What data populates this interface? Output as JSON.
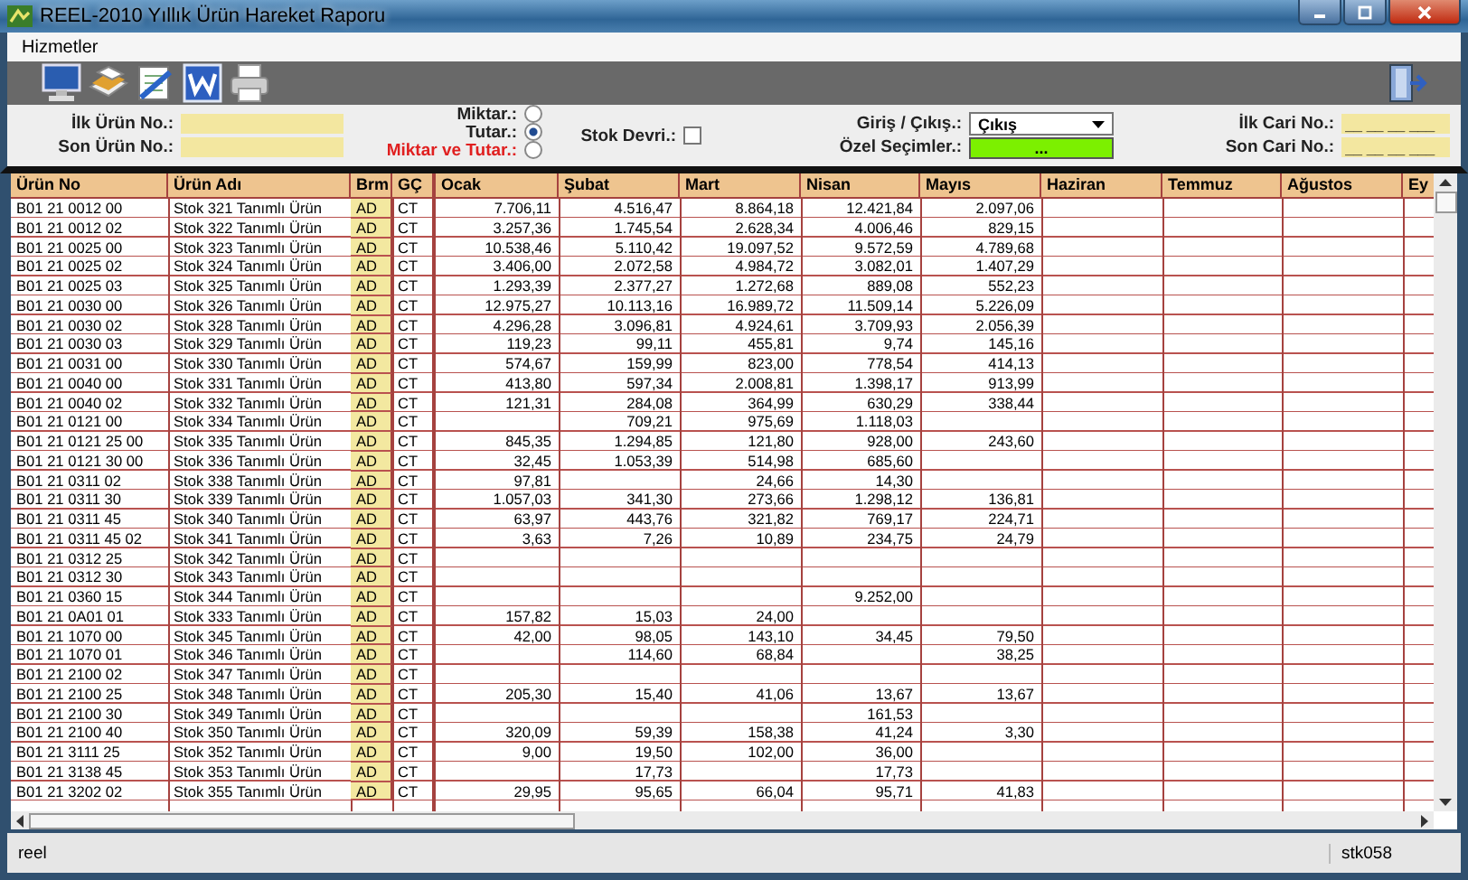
{
  "window": {
    "title": "REEL-2010 Yıllık Ürün Hareket Raporu"
  },
  "menu": [
    "Hizmetler"
  ],
  "filters": {
    "first_product": {
      "label": "İlk Ürün No.:"
    },
    "last_product": {
      "label": "Son Ürün No.:"
    },
    "radios": [
      {
        "label": "Miktar.:",
        "selected": false,
        "kind": "normal"
      },
      {
        "label": "Tutar.:",
        "selected": true,
        "kind": "normal"
      },
      {
        "label": "Miktar ve Tutar.:",
        "selected": false,
        "kind": "highlight"
      }
    ],
    "stock_turnover": {
      "label": "Stok Devri.:",
      "checked": false
    },
    "direction": {
      "label": "Giriş / Çıkış.:",
      "value": "Çıkış"
    },
    "special": {
      "label": "Özel Seçimler.:",
      "button": "..."
    },
    "first_account": {
      "label": "İlk Cari No.:",
      "value": "__ __ __ ___"
    },
    "last_account": {
      "label": "Son Cari No.:",
      "value": "__ __ __ ___"
    }
  },
  "table": {
    "columns": [
      "Ürün No",
      "Ürün Adı",
      "Brm",
      "GÇ",
      "Ocak",
      "Şubat",
      "Mart",
      "Nisan",
      "Mayıs",
      "Haziran",
      "Temmuz",
      "Ağustos",
      "Ey"
    ],
    "rows": [
      {
        "code": "B01 21 0012 00",
        "name": "Stok 321 Tanımlı Ürün",
        "unit": "AD",
        "gc": "CT",
        "ocak": "7.706,11",
        "subat": "4.516,47",
        "mart": "8.864,18",
        "nisan": "12.421,84",
        "mayis": "2.097,06"
      },
      {
        "code": "B01 21 0012 02",
        "name": "Stok 322 Tanımlı Ürün",
        "unit": "AD",
        "gc": "CT",
        "ocak": "3.257,36",
        "subat": "1.745,54",
        "mart": "2.628,34",
        "nisan": "4.006,46",
        "mayis": "829,15"
      },
      {
        "code": "B01 21 0025 00",
        "name": "Stok 323 Tanımlı Ürün",
        "unit": "AD",
        "gc": "CT",
        "ocak": "10.538,46",
        "subat": "5.110,42",
        "mart": "19.097,52",
        "nisan": "9.572,59",
        "mayis": "4.789,68"
      },
      {
        "code": "B01 21 0025 02",
        "name": "Stok 324 Tanımlı Ürün",
        "unit": "AD",
        "gc": "CT",
        "ocak": "3.406,00",
        "subat": "2.072,58",
        "mart": "4.984,72",
        "nisan": "3.082,01",
        "mayis": "1.407,29"
      },
      {
        "code": "B01 21 0025 03",
        "name": "Stok 325 Tanımlı Ürün",
        "unit": "AD",
        "gc": "CT",
        "ocak": "1.293,39",
        "subat": "2.377,27",
        "mart": "1.272,68",
        "nisan": "889,08",
        "mayis": "552,23"
      },
      {
        "code": "B01 21 0030 00",
        "name": "Stok 326 Tanımlı Ürün",
        "unit": "AD",
        "gc": "CT",
        "ocak": "12.975,27",
        "subat": "10.113,16",
        "mart": "16.989,72",
        "nisan": "11.509,14",
        "mayis": "5.226,09"
      },
      {
        "code": "B01 21 0030 02",
        "name": "Stok 328 Tanımlı Ürün",
        "unit": "AD",
        "gc": "CT",
        "ocak": "4.296,28",
        "subat": "3.096,81",
        "mart": "4.924,61",
        "nisan": "3.709,93",
        "mayis": "2.056,39"
      },
      {
        "code": "B01 21 0030 03",
        "name": "Stok 329 Tanımlı Ürün",
        "unit": "AD",
        "gc": "CT",
        "ocak": "119,23",
        "subat": "99,11",
        "mart": "455,81",
        "nisan": "9,74",
        "mayis": "145,16"
      },
      {
        "code": "B01 21 0031 00",
        "name": "Stok 330 Tanımlı Ürün",
        "unit": "AD",
        "gc": "CT",
        "ocak": "574,67",
        "subat": "159,99",
        "mart": "823,00",
        "nisan": "778,54",
        "mayis": "414,13"
      },
      {
        "code": "B01 21 0040 00",
        "name": "Stok 331 Tanımlı Ürün",
        "unit": "AD",
        "gc": "CT",
        "ocak": "413,80",
        "subat": "597,34",
        "mart": "2.008,81",
        "nisan": "1.398,17",
        "mayis": "913,99"
      },
      {
        "code": "B01 21 0040 02",
        "name": "Stok 332 Tanımlı Ürün",
        "unit": "AD",
        "gc": "CT",
        "ocak": "121,31",
        "subat": "284,08",
        "mart": "364,99",
        "nisan": "630,29",
        "mayis": "338,44"
      },
      {
        "code": "B01 21 0121 00",
        "name": "Stok 334 Tanımlı Ürün",
        "unit": "AD",
        "gc": "CT",
        "subat": "709,21",
        "mart": "975,69",
        "nisan": "1.118,03"
      },
      {
        "code": "B01 21 0121 25 00",
        "name": "Stok 335 Tanımlı Ürün",
        "unit": "AD",
        "gc": "CT",
        "ocak": "845,35",
        "subat": "1.294,85",
        "mart": "121,80",
        "nisan": "928,00",
        "mayis": "243,60"
      },
      {
        "code": "B01 21 0121 30 00",
        "name": "Stok 336 Tanımlı Ürün",
        "unit": "AD",
        "gc": "CT",
        "ocak": "32,45",
        "subat": "1.053,39",
        "mart": "514,98",
        "nisan": "685,60"
      },
      {
        "code": "B01 21 0311 02",
        "name": "Stok 338 Tanımlı Ürün",
        "unit": "AD",
        "gc": "CT",
        "ocak": "97,81",
        "mart": "24,66",
        "nisan": "14,30"
      },
      {
        "code": "B01 21 0311 30",
        "name": "Stok 339 Tanımlı Ürün",
        "unit": "AD",
        "gc": "CT",
        "ocak": "1.057,03",
        "subat": "341,30",
        "mart": "273,66",
        "nisan": "1.298,12",
        "mayis": "136,81"
      },
      {
        "code": "B01 21 0311 45",
        "name": "Stok 340 Tanımlı Ürün",
        "unit": "AD",
        "gc": "CT",
        "ocak": "63,97",
        "subat": "443,76",
        "mart": "321,82",
        "nisan": "769,17",
        "mayis": "224,71"
      },
      {
        "code": "B01 21 0311 45 02",
        "name": "Stok 341 Tanımlı Ürün",
        "unit": "AD",
        "gc": "CT",
        "ocak": "3,63",
        "subat": "7,26",
        "mart": "10,89",
        "nisan": "234,75",
        "mayis": "24,79"
      },
      {
        "code": "B01 21 0312 25",
        "name": "Stok 342 Tanımlı Ürün",
        "unit": "AD",
        "gc": "CT"
      },
      {
        "code": "B01 21 0312 30",
        "name": "Stok 343 Tanımlı Ürün",
        "unit": "AD",
        "gc": "CT"
      },
      {
        "code": "B01 21 0360 15",
        "name": "Stok 344 Tanımlı Ürün",
        "unit": "AD",
        "gc": "CT",
        "nisan": "9.252,00"
      },
      {
        "code": "B01 21 0A01 01",
        "name": "Stok 333 Tanımlı Ürün",
        "unit": "AD",
        "gc": "CT",
        "ocak": "157,82",
        "subat": "15,03",
        "mart": "24,00"
      },
      {
        "code": "B01 21 1070 00",
        "name": "Stok 345 Tanımlı Ürün",
        "unit": "AD",
        "gc": "CT",
        "ocak": "42,00",
        "subat": "98,05",
        "mart": "143,10",
        "nisan": "34,45",
        "mayis": "79,50"
      },
      {
        "code": "B01 21 1070 01",
        "name": "Stok 346 Tanımlı Ürün",
        "unit": "AD",
        "gc": "CT",
        "subat": "114,60",
        "mart": "68,84",
        "mayis": "38,25"
      },
      {
        "code": "B01 21 2100 02",
        "name": "Stok 347 Tanımlı Ürün",
        "unit": "AD",
        "gc": "CT"
      },
      {
        "code": "B01 21 2100 25",
        "name": "Stok 348 Tanımlı Ürün",
        "unit": "AD",
        "gc": "CT",
        "ocak": "205,30",
        "subat": "15,40",
        "mart": "41,06",
        "nisan": "13,67",
        "mayis": "13,67"
      },
      {
        "code": "B01 21 2100 30",
        "name": "Stok 349 Tanımlı Ürün",
        "unit": "AD",
        "gc": "CT",
        "nisan": "161,53"
      },
      {
        "code": "B01 21 2100 40",
        "name": "Stok 350 Tanımlı Ürün",
        "unit": "AD",
        "gc": "CT",
        "ocak": "320,09",
        "subat": "59,39",
        "mart": "158,38",
        "nisan": "41,24",
        "mayis": "3,30"
      },
      {
        "code": "B01 21 3111 25",
        "name": "Stok 352 Tanımlı Ürün",
        "unit": "AD",
        "gc": "CT",
        "ocak": "9,00",
        "subat": "19,50",
        "mart": "102,00",
        "nisan": "36,00"
      },
      {
        "code": "B01 21 3138 45",
        "name": "Stok 353 Tanımlı Ürün",
        "unit": "AD",
        "gc": "CT",
        "subat": "17,73",
        "nisan": "17,73"
      },
      {
        "code": "B01 21 3202 02",
        "name": "Stok 355 Tanımlı Ürün",
        "unit": "AD",
        "gc": "CT",
        "ocak": "29,95",
        "subat": "95,65",
        "mart": "66,04",
        "nisan": "95,71",
        "mayis": "41,83"
      }
    ]
  },
  "status_bar": [
    "reel",
    "stk058"
  ]
}
